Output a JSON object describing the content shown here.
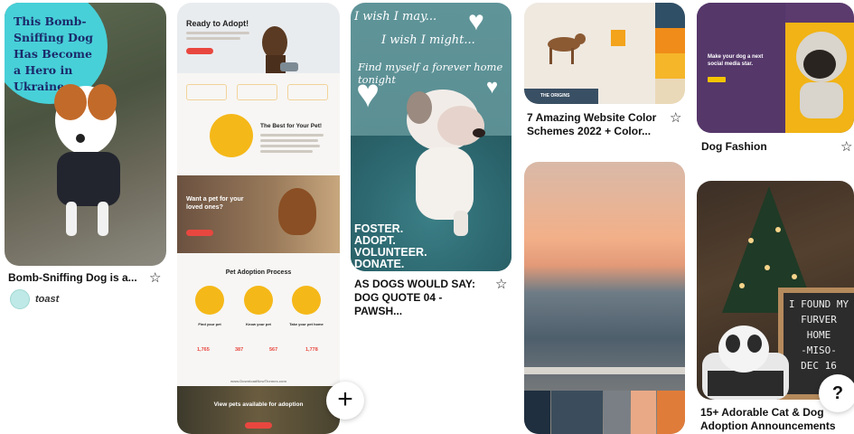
{
  "pins": [
    {
      "caption": "Bomb-Sniffing Dog is a...",
      "overlay_lines": [
        "This Bomb-",
        "Sniffing Dog",
        "Has Become",
        "a Hero in",
        "Ukraine"
      ],
      "creator": "toast",
      "save_icon": "star-icon"
    },
    {
      "headline": "Ready to Adopt!",
      "best_title": "The Best for Your Pet!",
      "want_title": "Want a pet for your loved ones?",
      "process_title": "Pet Adoption Process",
      "steps": [
        "Find your pet",
        "Know your pet",
        "Take your pet home"
      ],
      "stats": [
        "1,765",
        "387",
        "567",
        "1,778"
      ],
      "footer_title": "View pets available for adoption",
      "footer_url": "www.DownloadNewThemes.com"
    },
    {
      "quote_lines": [
        "I wish I may...",
        "I wish I might...",
        "Find myself a forever home tonight"
      ],
      "bottom_lines": [
        "FOSTER.",
        "ADOPT.",
        "VOLUNTEER.",
        "DONATE."
      ],
      "caption": "AS DOGS WOULD SAY: DOG QUOTE 04 - PAWSH...",
      "save_icon": "star-icon"
    },
    {
      "caption": "7 Amazing Website Color Schemes 2022 + Color...",
      "save_icon": "star-icon",
      "swatches": [
        "#1f2f3f",
        "#7a7f86",
        "#e9a987",
        "#f0a77e",
        "#e07c3a"
      ],
      "swatch_label": "THE ORIGINS"
    },
    {
      "caption": "Dog Fashion",
      "save_icon": "star-icon",
      "heading": "Make your dog a next social media star."
    },
    {
      "caption": "15+ Adorable Cat & Dog Adoption Announcements",
      "board_lines": [
        "I FOUND MY",
        "FURVER",
        "HOME",
        "-MISO-",
        "DEC 16"
      ]
    }
  ],
  "controls": {
    "add_label": "+",
    "help_label": "?"
  },
  "colors": {
    "accent_red": "#e8473f",
    "teal": "#47d0d8",
    "navy": "#1b2a6b"
  }
}
